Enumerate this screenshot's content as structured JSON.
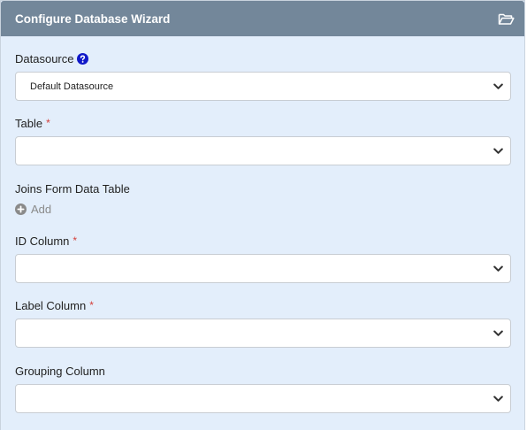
{
  "panel": {
    "title": "Configure Database Wizard",
    "header_icon": "folder-open-icon"
  },
  "fields": {
    "datasource": {
      "label": "Datasource",
      "value": "Default Datasource",
      "help_icon": "question-circle-icon"
    },
    "table": {
      "label": "Table",
      "required_mark": "*",
      "value": ""
    },
    "joins": {
      "label": "Joins Form Data Table",
      "add_label": "Add"
    },
    "id_column": {
      "label": "ID Column",
      "required_mark": "*",
      "value": ""
    },
    "label_column": {
      "label": "Label Column",
      "required_mark": "*",
      "value": ""
    },
    "grouping_column": {
      "label": "Grouping Column",
      "value": ""
    }
  },
  "colors": {
    "header_bg": "#73879a",
    "panel_bg": "#e3eefb",
    "required": "#d43f3a",
    "help_icon": "#1018c8"
  }
}
